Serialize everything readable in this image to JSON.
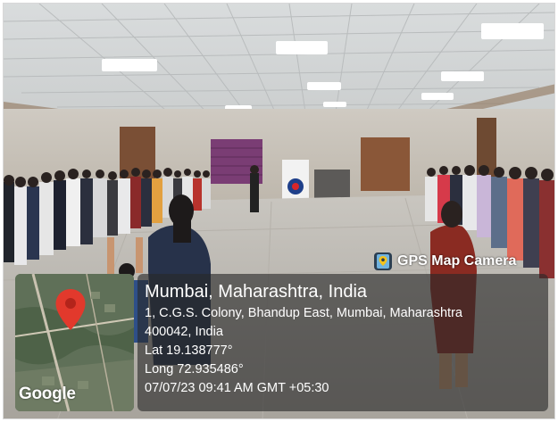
{
  "overlay": {
    "app_name": "GPS Map Camera",
    "map_label": "Google",
    "location_title": "Mumbai, Maharashtra, India",
    "address_line1": "1, C.G.S. Colony, Bhandup East, Mumbai, Maharashtra",
    "address_line2": "400042, India",
    "latitude": "Lat 19.138777°",
    "longitude": "Long 72.935486°",
    "datetime": "07/07/23 09:41 AM GMT +05:30"
  },
  "colors": {
    "pin": "#e2392c",
    "panel_bg": "rgba(40,40,40,0.62)"
  }
}
